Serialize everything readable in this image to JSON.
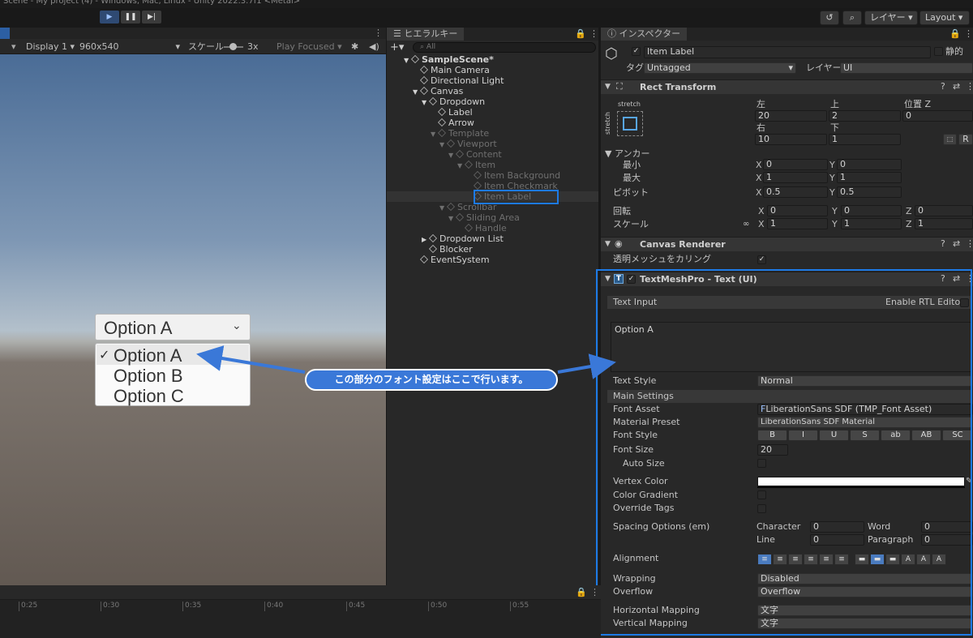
{
  "window": {
    "title": "Scene - My project (4) - Windows, Mac, Linux - Unity 2022.3.7f1 <Metal>"
  },
  "toolbar": {
    "layers_label": "レイヤー",
    "layout_label": "Layout"
  },
  "game": {
    "display": "Display 1",
    "resolution": "960x540",
    "scale_label": "スケール",
    "scale_value": "3x",
    "play_focused": "Play Focused",
    "dropdown_value": "Option A",
    "options": [
      {
        "label": "Option A",
        "checked": true
      },
      {
        "label": "Option B",
        "checked": false
      },
      {
        "label": "Option C",
        "checked": false
      }
    ]
  },
  "hierarchy": {
    "tab": "ヒエラルキー",
    "search_placeholder": "All",
    "items": [
      {
        "label": "SampleScene*",
        "depth": 0,
        "arrow": "▼",
        "dim": false,
        "bold": true
      },
      {
        "label": "Main Camera",
        "depth": 1,
        "arrow": "",
        "dim": false
      },
      {
        "label": "Directional Light",
        "depth": 1,
        "arrow": "",
        "dim": false
      },
      {
        "label": "Canvas",
        "depth": 1,
        "arrow": "▼",
        "dim": false
      },
      {
        "label": "Dropdown",
        "depth": 2,
        "arrow": "▼",
        "dim": false
      },
      {
        "label": "Label",
        "depth": 3,
        "arrow": "",
        "dim": false
      },
      {
        "label": "Arrow",
        "depth": 3,
        "arrow": "",
        "dim": false
      },
      {
        "label": "Template",
        "depth": 3,
        "arrow": "▼",
        "dim": true
      },
      {
        "label": "Viewport",
        "depth": 4,
        "arrow": "▼",
        "dim": true
      },
      {
        "label": "Content",
        "depth": 5,
        "arrow": "▼",
        "dim": true
      },
      {
        "label": "Item",
        "depth": 6,
        "arrow": "▼",
        "dim": true
      },
      {
        "label": "Item Background",
        "depth": 7,
        "arrow": "",
        "dim": true
      },
      {
        "label": "Item Checkmark",
        "depth": 7,
        "arrow": "",
        "dim": true
      },
      {
        "label": "Item Label",
        "depth": 7,
        "arrow": "",
        "dim": true
      },
      {
        "label": "Scrollbar",
        "depth": 4,
        "arrow": "▼",
        "dim": true
      },
      {
        "label": "Sliding Area",
        "depth": 5,
        "arrow": "▼",
        "dim": true
      },
      {
        "label": "Handle",
        "depth": 6,
        "arrow": "",
        "dim": true
      },
      {
        "label": "Dropdown List",
        "depth": 2,
        "arrow": "▶",
        "dim": false
      },
      {
        "label": "Blocker",
        "depth": 2,
        "arrow": "",
        "dim": false
      },
      {
        "label": "EventSystem",
        "depth": 1,
        "arrow": "",
        "dim": false
      }
    ]
  },
  "inspector": {
    "tab": "インスペクター",
    "object_name": "Item Label",
    "static_label": "静的",
    "tag_label": "タグ",
    "tag_value": "Untagged",
    "layer_label": "レイヤー",
    "layer_value": "UI",
    "rect": {
      "title": "Rect Transform",
      "stretch_top": "stretch",
      "stretch_side": "stretch",
      "left_label": "左",
      "left": "20",
      "top_label": "上",
      "top": "2",
      "posz_label": "位置 Z",
      "posz": "0",
      "right_label": "右",
      "right": "10",
      "bottom_label": "下",
      "bottom": "1",
      "blueprint_btn": "R",
      "anchor_label": "アンカー",
      "min_label": "最小",
      "min_x": "0",
      "min_y": "0",
      "max_label": "最大",
      "max_x": "1",
      "max_y": "1",
      "pivot_label": "ピボット",
      "pivot_x": "0.5",
      "pivot_y": "0.5",
      "rot_label": "回転",
      "rot_x": "0",
      "rot_y": "0",
      "rot_z": "0",
      "scale_label": "スケール",
      "scale_x": "1",
      "scale_y": "1",
      "scale_z": "1",
      "x": "X",
      "y": "Y",
      "z": "Z"
    },
    "canvas_renderer": {
      "title": "Canvas Renderer",
      "cull_label": "透明メッシュをカリング"
    },
    "tmp": {
      "title": "TextMeshPro - Text (UI)",
      "text_input": "Text Input",
      "rtl": "Enable RTL Editor",
      "text": "Option A",
      "text_style_label": "Text Style",
      "text_style": "Normal",
      "main_settings": "Main Settings",
      "font_asset_label": "Font Asset",
      "font_asset": "LiberationSans SDF (TMP_Font Asset)",
      "material_label": "Material Preset",
      "material": "LiberationSans SDF Material",
      "font_style_label": "Font Style",
      "font_styles": [
        "B",
        "I",
        "U",
        "S",
        "ab",
        "AB",
        "SC"
      ],
      "font_size_label": "Font Size",
      "font_size": "20",
      "auto_size_label": "Auto Size",
      "vertex_color_label": "Vertex Color",
      "color_gradient_label": "Color Gradient",
      "override_tags_label": "Override Tags",
      "spacing_label": "Spacing Options (em)",
      "character_label": "Character",
      "character": "0",
      "word_label": "Word",
      "word": "0",
      "line_label": "Line",
      "line": "0",
      "paragraph_label": "Paragraph",
      "paragraph": "0",
      "alignment_label": "Alignment",
      "wrapping_label": "Wrapping",
      "wrapping": "Disabled",
      "overflow_label": "Overflow",
      "overflow": "Overflow",
      "hmap_label": "Horizontal Mapping",
      "hmap": "文字",
      "vmap_label": "Vertical Mapping",
      "vmap": "文字"
    }
  },
  "callout": {
    "text": "この部分のフォント設定はここで行います。"
  },
  "timeline": {
    "ticks": [
      "0:25",
      "0:30",
      "0:35",
      "0:40",
      "0:45",
      "0:50",
      "0:55"
    ]
  },
  "colors": {
    "highlight": "#1d7ae5",
    "callout": "#3a78d8"
  }
}
